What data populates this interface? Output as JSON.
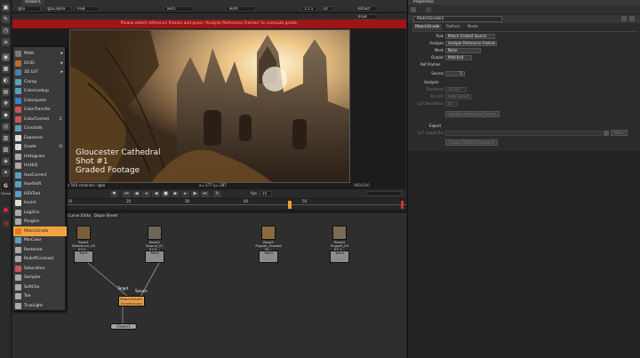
{
  "viewer": {
    "tab": "Viewer1",
    "channels": "rgba",
    "alpha": "rgba.alpha",
    "colorspace": "RGB",
    "input_a": "Text1",
    "input_b": "Text4",
    "zoom": "1:1.5",
    "mode": "2D",
    "view": "default",
    "lut": "sRGB",
    "warning": "Please select reference frames and press 'Analyze Reference Frames' to compute grade.",
    "caption_lines": [
      "Gloucester Cathedral",
      "Shot #1",
      "Graded Footage"
    ],
    "info_left": "x 540  channels: rgba",
    "info_mid": "x=-177 y= 287",
    "corner_label": "960x540",
    "fps_label": "fps",
    "fps_value": "24",
    "timeline_ticks": [
      "10",
      "20",
      "30",
      "40",
      "50"
    ]
  },
  "toolbar": {
    "icons": [
      "image-icon",
      "draw-icon",
      "time-icon",
      "channel-icon",
      "color-icon",
      "filter-icon",
      "keyer-icon",
      "merge-icon",
      "transform-icon",
      "3d-icon",
      "views-icon",
      "metadata-icon",
      "toolsets-icon",
      "other-icon",
      "furnace-icon",
      "gizmo-icon",
      "cara-icon",
      "help-icon"
    ],
    "labels": [
      "G",
      "Gizmo"
    ]
  },
  "menu": {
    "items": [
      {
        "label": "Math",
        "arrow": true,
        "color": "#7a7a7a"
      },
      {
        "label": "OCIO",
        "arrow": true,
        "color": "#c06a2b"
      },
      {
        "label": "3D LUT",
        "arrow": true,
        "color": "#4a7fb0"
      },
      {
        "label": "Clamp",
        "color": "#5aa0c0"
      },
      {
        "label": "ColorLookup",
        "color": "#5aa0c0"
      },
      {
        "label": "Colorspace",
        "color": "#3f7ec8"
      },
      {
        "label": "ColorTransfer",
        "color": "#c55"
      },
      {
        "label": "ColorCorrect",
        "shortcut": "C",
        "color": "#c55"
      },
      {
        "label": "Crosstalk",
        "color": "#5aa0c0"
      },
      {
        "label": "Exposure",
        "color": "#ddd"
      },
      {
        "label": "Grade",
        "shortcut": "G",
        "color": "#ddd"
      },
      {
        "label": "Histogram",
        "color": "#aaa"
      },
      {
        "label": "HistEQ",
        "color": "#aaa"
      },
      {
        "label": "HueCorrect",
        "color": "#5aa0c0"
      },
      {
        "label": "HueShift",
        "color": "#5aa0c0"
      },
      {
        "label": "HSVTool",
        "color": "#5aa0c0"
      },
      {
        "label": "Invert",
        "color": "#ddd"
      },
      {
        "label": "Log2Lin",
        "color": "#aaa"
      },
      {
        "label": "PLogLin",
        "color": "#aaa"
      },
      {
        "label": "MatchGrade",
        "color": "#e07b1a",
        "selected": true
      },
      {
        "label": "MinColor",
        "color": "#5aa0c0"
      },
      {
        "label": "Posterize",
        "color": "#aaa"
      },
      {
        "label": "RolloffContrast",
        "color": "#aaa"
      },
      {
        "label": "Saturation",
        "color": "#c55"
      },
      {
        "label": "Sampler",
        "color": "#aaa"
      },
      {
        "label": "SoftClip",
        "color": "#aaa"
      },
      {
        "label": "Toe",
        "color": "#aaa"
      },
      {
        "label": "TrueLight",
        "color": "#aaa"
      }
    ]
  },
  "graph": {
    "tabs": [
      "Node Graph",
      "Curve Editor",
      "Dope Sheet"
    ],
    "nodes": [
      {
        "top": "Read1",
        "sub": "Reference_03 03.0...",
        "name": "Text1",
        "body": "Gloucester Cathed...\nShot #1\nGraded Fo..."
      },
      {
        "top": "Read2",
        "sub": "Source_01 07.0...",
        "name": "Text2",
        "body": "Gloucester Cathed...\nShot #1\nSource..."
      },
      {
        "top": "Read3",
        "sub": "Puppet_Graded 03...",
        "name": "Text3",
        "body": "Puppet_Planet...\nShot #1\nGraded..."
      },
      {
        "top": "Read4",
        "sub": "Puppet_03 07.1...",
        "name": "Text4",
        "body": "Puppet_Planet...\nShot #1\nSource..."
      }
    ],
    "matchgrade_node": {
      "target": "Target",
      "source": "Source",
      "name": "MatchGrade1",
      "sub": "(Grade/Auto)"
    },
    "viewer_node": "Viewer1"
  },
  "properties": {
    "title": "Properties",
    "node_name": "MatchGrade1",
    "tabs": [
      "MatchGrade",
      "Python",
      "Node"
    ],
    "rows": [
      {
        "label": "Task",
        "value": "Match Graded Source"
      },
      {
        "label": "Analyze",
        "value": "Analyze Reference Frames"
      },
      {
        "label": "Mask",
        "value": "None"
      },
      {
        "label": "Output",
        "value": "Matched"
      }
    ],
    "ref_frames_header": "Ref Frames",
    "source_label": "Source",
    "source_value": "1",
    "analysis_header": "Analysis",
    "transform_label": "Transform",
    "transform_value": "3D LUT",
    "prelut_label": "Pre LUT",
    "prelut_value": "Auto Detect",
    "lutres_label": "LUT Resolution",
    "lutres_value": "32",
    "analyze_button": "Analyze Reference Frames",
    "export_header": "Export",
    "lutfile_label": "LUT output file",
    "write_button": "Write",
    "create_button": "Create OCIOFileTransform"
  }
}
